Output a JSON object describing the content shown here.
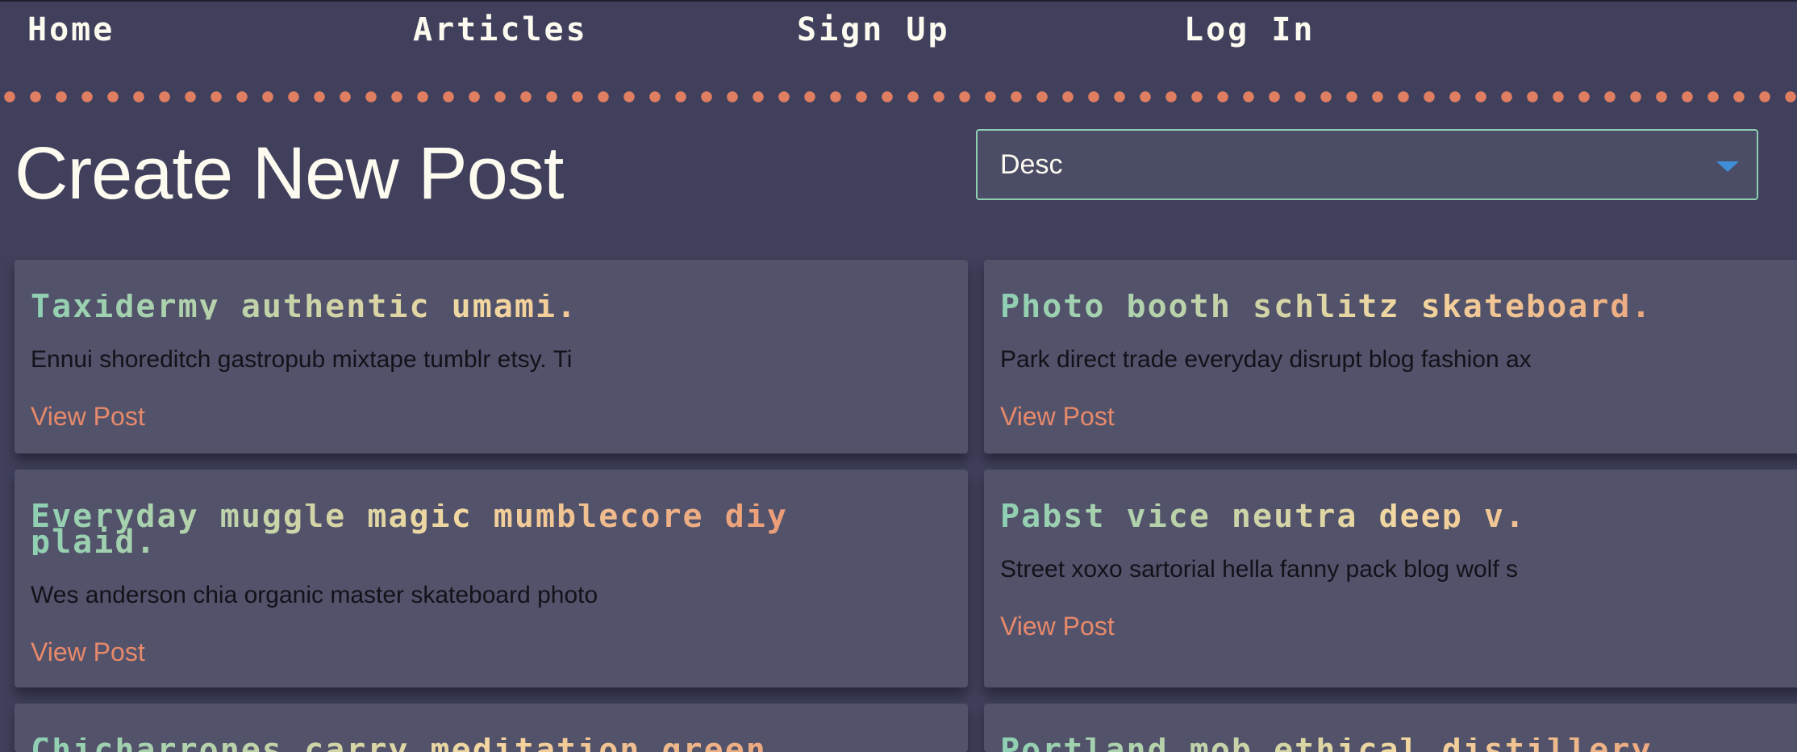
{
  "nav": {
    "home": "Home",
    "articles": "Articles",
    "signup": "Sign Up",
    "login": "Log In"
  },
  "page": {
    "title": "Create New Post"
  },
  "sort": {
    "selected": "Desc"
  },
  "posts": [
    {
      "title": "Taxidermy authentic umami.",
      "excerpt": "Ennui shoreditch gastropub mixtape tumblr etsy. Ti",
      "link": "View Post"
    },
    {
      "title": "Photo booth schlitz skateboard.",
      "excerpt": "Park direct trade everyday disrupt blog fashion ax",
      "link": "View Post"
    },
    {
      "title": "Everyday muggle magic mumblecore diy plaid.",
      "excerpt": "Wes anderson chia organic master skateboard photo",
      "link": "View Post"
    },
    {
      "title": "Pabst vice neutra deep v.",
      "excerpt": "Street xoxo sartorial hella fanny pack blog wolf s",
      "link": "View Post"
    },
    {
      "title": "Chicharrones carry meditation green",
      "excerpt": "",
      "link": ""
    },
    {
      "title": "Portland mob ethical distillery",
      "excerpt": "",
      "link": ""
    }
  ],
  "colors": {
    "background": "#40405c",
    "card": "#52536b",
    "accent": "#e8896a",
    "mint": "#8ecfb2",
    "cream": "#f4d7a0",
    "text_light": "#fdfaf0"
  }
}
